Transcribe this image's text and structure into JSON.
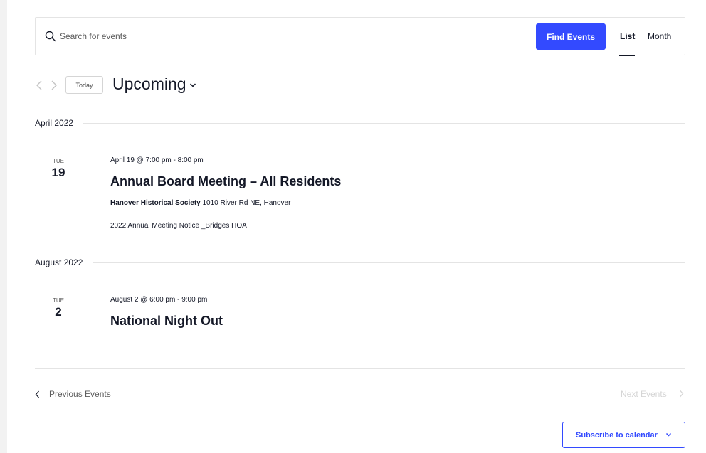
{
  "search": {
    "placeholder": "Search for events",
    "find_button": "Find Events",
    "views": {
      "list": "List",
      "month": "Month"
    }
  },
  "nav": {
    "today": "Today",
    "upcoming": "Upcoming"
  },
  "months": [
    {
      "label": "April 2022",
      "events": [
        {
          "dow": "TUE",
          "day": "19",
          "time": "April 19 @ 7:00 pm - 8:00 pm",
          "title": "Annual Board Meeting – All Residents",
          "venue_name": "Hanover Historical Society",
          "venue_address": "1010 River Rd NE, Hanover",
          "description": "2022 Annual Meeting Notice _Bridges HOA"
        }
      ]
    },
    {
      "label": "August 2022",
      "events": [
        {
          "dow": "TUE",
          "day": "2",
          "time": "August 2 @ 6:00 pm - 9:00 pm",
          "title": "National Night Out"
        }
      ]
    }
  ],
  "footer": {
    "previous": "Previous Events",
    "next": "Next Events",
    "subscribe": "Subscribe to calendar"
  },
  "colors": {
    "accent": "#334aff",
    "text": "#141827",
    "muted": "#5d5d5d",
    "disabled": "#d5d5d5",
    "border": "#e4e4e4"
  }
}
